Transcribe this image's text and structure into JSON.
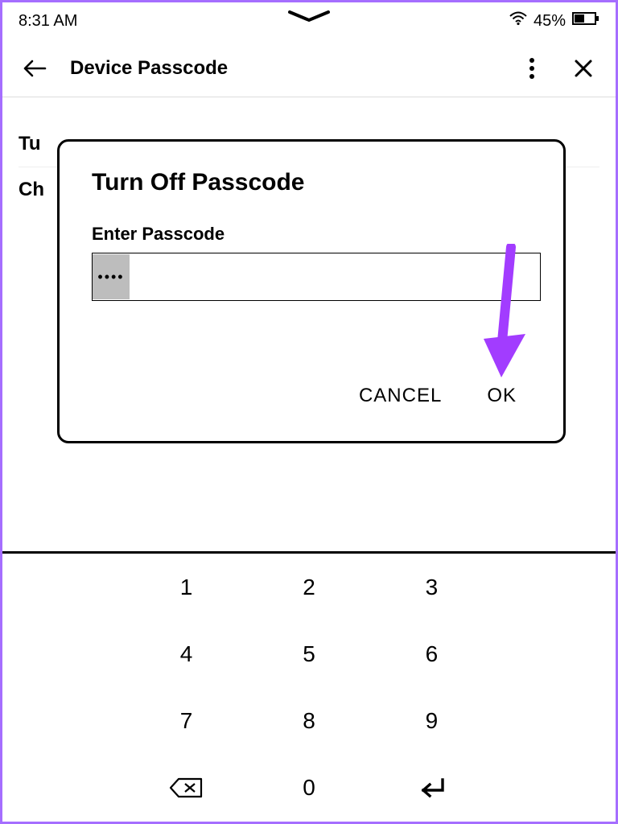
{
  "status": {
    "time": "8:31 AM",
    "battery_pct": "45%"
  },
  "header": {
    "title": "Device Passcode"
  },
  "background_items": [
    "Tu",
    "Ch"
  ],
  "dialog": {
    "title": "Turn Off Passcode",
    "label": "Enter Passcode",
    "input_mask": "••••",
    "cancel": "CANCEL",
    "ok": "OK"
  },
  "keypad": {
    "rows": [
      [
        "",
        "1",
        "2",
        "3",
        ""
      ],
      [
        "",
        "4",
        "5",
        "6",
        ""
      ],
      [
        "",
        "7",
        "8",
        "9",
        ""
      ],
      [
        "",
        "backspace",
        "0",
        "enter",
        ""
      ]
    ]
  }
}
